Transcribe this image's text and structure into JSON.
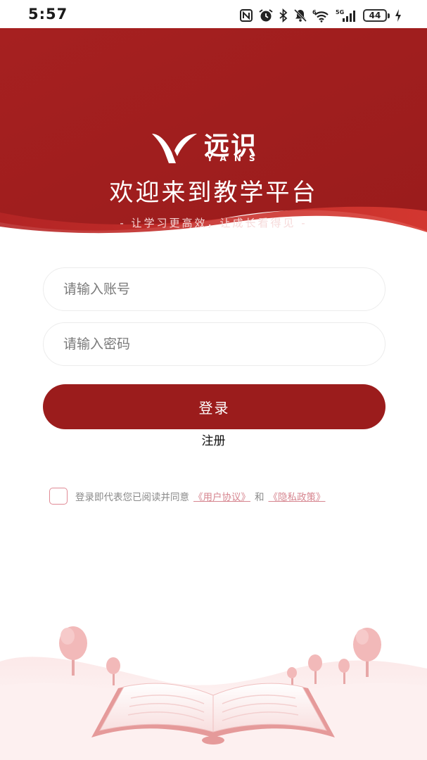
{
  "status_bar": {
    "time": "5:57",
    "battery": "44",
    "icons": [
      "nfc-icon",
      "alarm-icon",
      "bluetooth-icon",
      "mute-icon",
      "wifi-icon",
      "signal-5g-icon",
      "battery-icon",
      "charging-icon"
    ]
  },
  "header": {
    "logo_text": "远识",
    "logo_sub": "YANS",
    "welcome": "欢迎来到教学平台",
    "slogan": "- 让学习更高效，让成长看得见 -"
  },
  "form": {
    "account_placeholder": "请输入账号",
    "password_placeholder": "请输入密码",
    "login_label": "登录",
    "register_label": "注册"
  },
  "agreement": {
    "prefix": "登录即代表您已阅读并同意",
    "user_agreement": "《用户协议》",
    "and": "和",
    "privacy_policy": "《隐私政策》"
  },
  "colors": {
    "brand_red": "#9b1c1c",
    "header_red": "#a31f1f",
    "link_pink": "#d6858f"
  }
}
